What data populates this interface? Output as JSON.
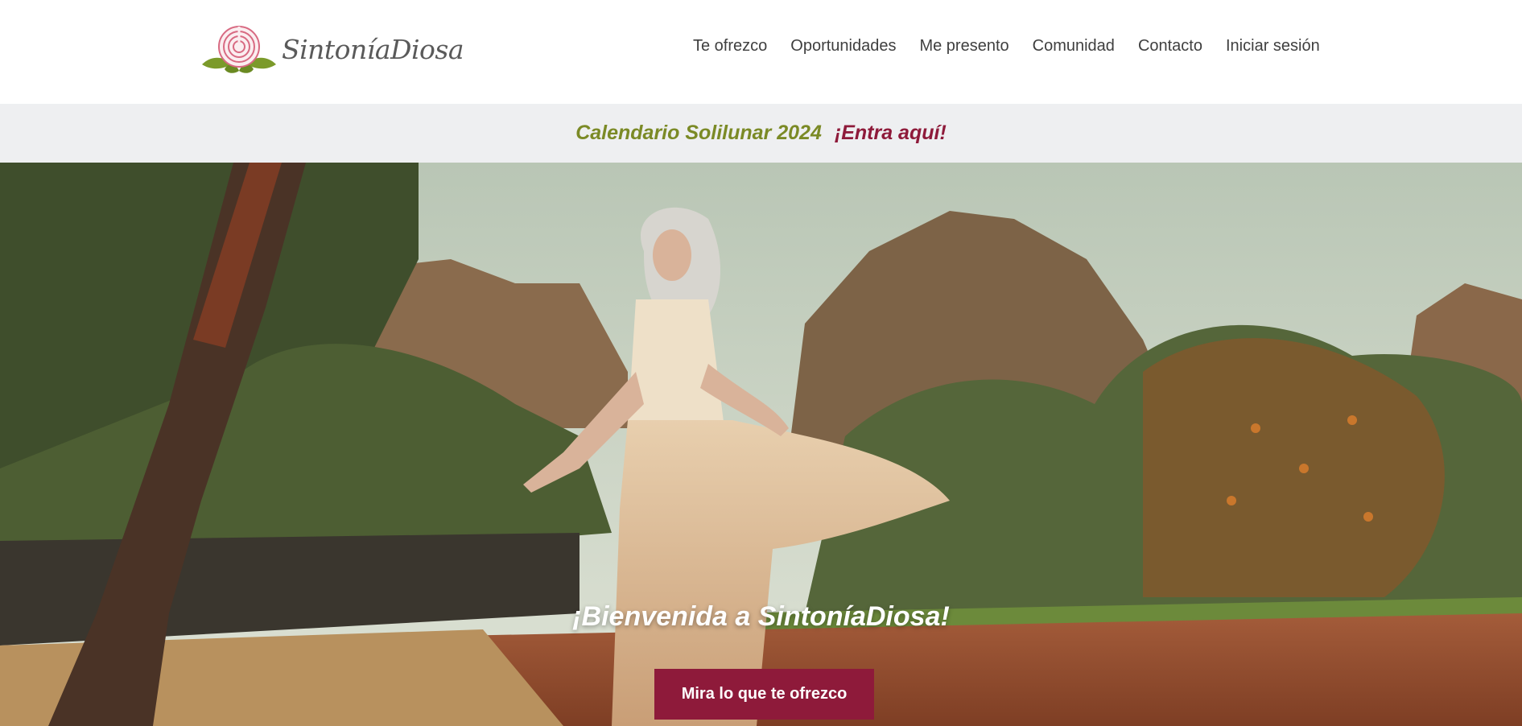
{
  "brand": {
    "name": "SintoníaDiosa",
    "logo_icon": "labyrinth-rose-with-leaves",
    "colors": {
      "accent": "#8e1a3a",
      "green": "#7b8a26",
      "promo_bg": "#eeeff1"
    }
  },
  "nav": {
    "items": [
      {
        "label": "Te ofrezco"
      },
      {
        "label": "Oportunidades"
      },
      {
        "label": "Me presento"
      },
      {
        "label": "Comunidad"
      },
      {
        "label": "Contacto"
      },
      {
        "label": "Iniciar sesión"
      }
    ]
  },
  "promo": {
    "title": "Calendario Solilunar 2024",
    "link": "¡Entra aquí!"
  },
  "hero": {
    "title": "¡Bienvenida a SintoníaDiosa!",
    "button_label": "Mira lo que te ofrezco",
    "image": "woman-dancing-in-garden-with-mountains"
  }
}
